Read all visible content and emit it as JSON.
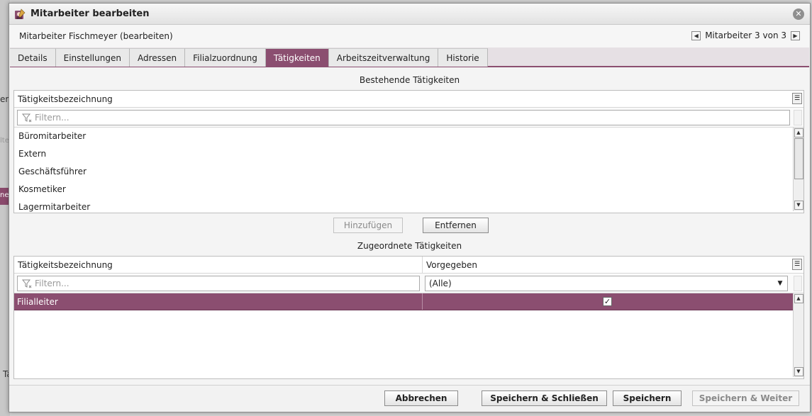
{
  "dialog": {
    "title": "Mitarbeiter bearbeiten",
    "subtitle": "Mitarbeiter Fischmeyer (bearbeiten)",
    "record_nav": "Mitarbeiter 3 von 3"
  },
  "background": {
    "fragment_1": "er",
    "fragment_2": "lte",
    "fragment_3": "ne",
    "fragment_4": "Ta"
  },
  "tabs": [
    {
      "label": "Details"
    },
    {
      "label": "Einstellungen"
    },
    {
      "label": "Adressen"
    },
    {
      "label": "Filialzuordnung"
    },
    {
      "label": "Tätigkeiten"
    },
    {
      "label": "Arbeitszeitverwaltung"
    },
    {
      "label": "Historie"
    }
  ],
  "existing": {
    "section_title": "Bestehende Tätigkeiten",
    "column": "Tätigkeitsbezeichnung",
    "filter_placeholder": "Filtern...",
    "items": [
      "Büromitarbeiter",
      "Extern",
      "Geschäftsführer",
      "Kosmetiker",
      "Lagermitarbeiter"
    ]
  },
  "actions": {
    "add": "Hinzufügen",
    "remove": "Entfernen"
  },
  "assigned": {
    "section_title": "Zugeordnete Tätigkeiten",
    "columns": [
      "Tätigkeitsbezeichnung",
      "Vorgegeben"
    ],
    "filter_placeholder": "Filtern...",
    "select_value": "(Alle)",
    "rows": [
      {
        "name": "Filialleiter",
        "checkmark": "✓"
      }
    ]
  },
  "footer": {
    "cancel": "Abbrechen",
    "save_close": "Speichern & Schließen",
    "save": "Speichern",
    "save_next": "Speichern & Weiter"
  },
  "colors": {
    "accent": "#8b4e70",
    "dialog_bg": "#f4f4f4"
  }
}
